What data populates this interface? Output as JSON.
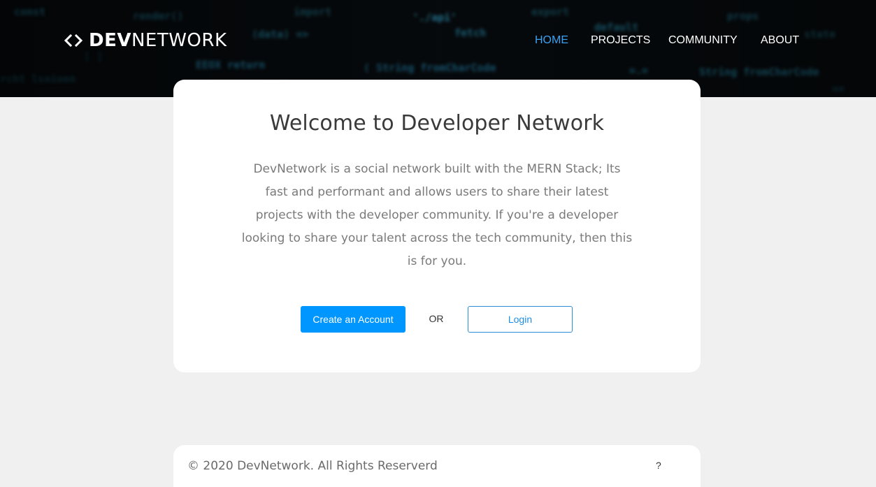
{
  "header": {
    "brand_bold": "DEV",
    "brand_light": "NETWORK",
    "nav": [
      {
        "label": "HOME",
        "active": true
      },
      {
        "label": "PROJECTS",
        "active": false
      },
      {
        "label": "COMMUNITY",
        "active": false
      },
      {
        "label": "ABOUT",
        "active": false
      }
    ]
  },
  "welcome": {
    "title": "Welcome to Developer Network",
    "description": "DevNetwork is a social network built with the MERN Stack; Its fast and performant and allows users to share their latest projects with the developer community. If you're a developer looking to share your talent across the tech community, then this is for you.",
    "create_label": "Create an Account",
    "or_label": "OR",
    "login_label": "Login"
  },
  "footer": {
    "copyright": "© 2020 DevNetwork. All Rights Reserverd",
    "help": "?"
  },
  "colors": {
    "accent": "#0096ff",
    "nav_active": "#3aa2f2",
    "page_bg": "#f0f0f0",
    "hero_bg": "#070b0e"
  }
}
